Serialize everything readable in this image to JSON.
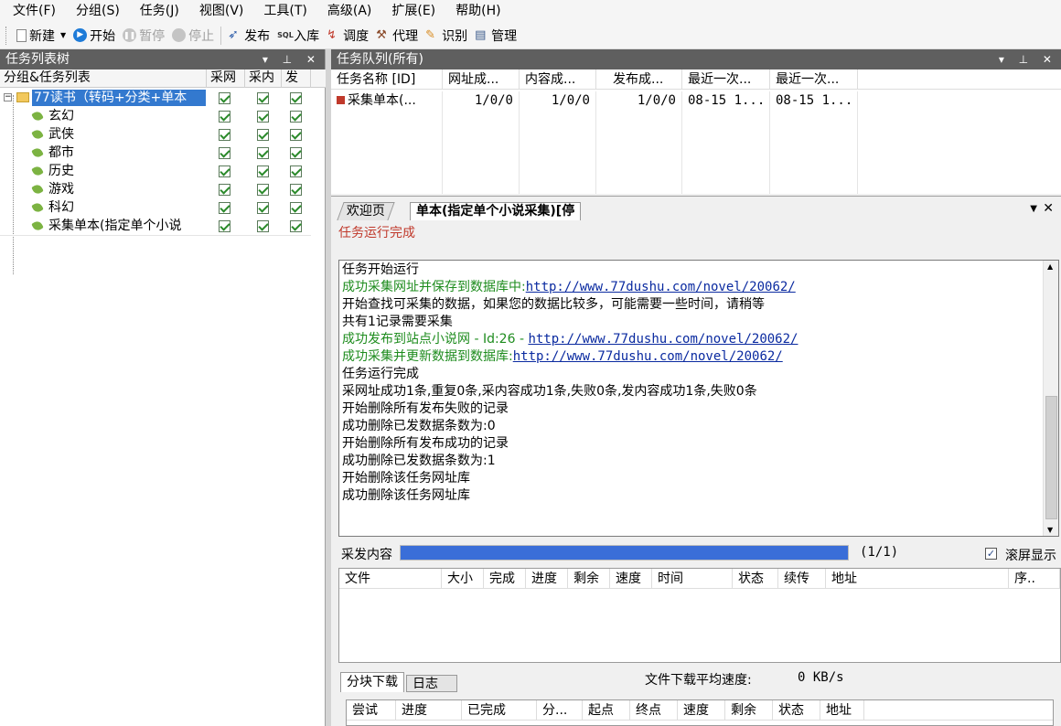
{
  "menu": [
    "文件(F)",
    "分组(S)",
    "任务(J)",
    "视图(V)",
    "工具(T)",
    "高级(A)",
    "扩展(E)",
    "帮助(H)"
  ],
  "toolbar": {
    "new": "新建",
    "start": "开始",
    "pause": "暂停",
    "stop": "停止",
    "publish": "发布",
    "import": "入库",
    "debug": "调度",
    "proxy": "代理",
    "recognize": "识别",
    "manage": "管理"
  },
  "left_panel": {
    "title": "任务列表树",
    "columns": [
      "分组&任务列表",
      "采网",
      "采内",
      "发"
    ],
    "group": "77读书（转码+分类+单本",
    "items": [
      "玄幻",
      "武侠",
      "都市",
      "历史",
      "游戏",
      "科幻",
      "采集单本(指定单个小说"
    ]
  },
  "queue_panel": {
    "title": "任务队列(所有)",
    "columns": [
      "任务名称 [ID]",
      "网址成...",
      "内容成...",
      "发布成...",
      "最近一次...",
      "最近一次..."
    ],
    "rows": [
      [
        "采集单本(...",
        "1/0/0",
        "1/0/0",
        "1/0/0",
        "08-15 1...",
        "08-15 1..."
      ]
    ]
  },
  "tabs": {
    "welcome": "欢迎页",
    "active": "单本(指定单个小说采集)[停"
  },
  "status_text": "任务运行完成",
  "log": [
    {
      "text": "任务开始运行",
      "color": "black",
      "link": ""
    },
    {
      "text": "成功采集网址并保存到数据库中:",
      "color": "green",
      "link": "http://www.77dushu.com/novel/20062/"
    },
    {
      "text": "开始查找可采集的数据，如果您的数据比较多，可能需要一些时间，请稍等",
      "color": "black",
      "link": ""
    },
    {
      "text": "共有1记录需要采集",
      "color": "black",
      "link": ""
    },
    {
      "text": "成功发布到站点小说网 - Id:26 - ",
      "color": "green",
      "link": "http://www.77dushu.com/novel/20062/"
    },
    {
      "text": "成功采集并更新数据到数据库:",
      "color": "green",
      "link": "http://www.77dushu.com/novel/20062/"
    },
    {
      "text": "任务运行完成",
      "color": "black",
      "link": ""
    },
    {
      "text": "采网址成功1条,重复0条,采内容成功1条,失败0条,发内容成功1条,失败0条",
      "color": "black",
      "link": ""
    },
    {
      "text": "开始删除所有发布失败的记录",
      "color": "black",
      "link": ""
    },
    {
      "text": "成功删除已发数据条数为:0",
      "color": "black",
      "link": ""
    },
    {
      "text": "开始删除所有发布成功的记录",
      "color": "black",
      "link": ""
    },
    {
      "text": "成功删除已发数据条数为:1",
      "color": "black",
      "link": ""
    },
    {
      "text": "开始删除该任务网址库",
      "color": "black",
      "link": ""
    },
    {
      "text": "成功删除该任务网址库",
      "color": "black",
      "link": ""
    }
  ],
  "progress": {
    "label": "采发内容",
    "fraction": 1.0,
    "count_text": "(1/1)",
    "scroll_label": "滚屏显示"
  },
  "file_grid": {
    "columns": [
      "文件",
      "大小",
      "完成",
      "进度",
      "剩余",
      "速度",
      "时间",
      "状态",
      "续传",
      "地址",
      "序.."
    ]
  },
  "bottom": {
    "tabs": [
      "分块下载",
      "日志"
    ],
    "avg_speed_label": "文件下载平均速度:",
    "avg_speed_value": "0 KB/s",
    "columns": [
      "尝试",
      "进度",
      "已完成",
      "分...",
      "起点",
      "终点",
      "速度",
      "剩余",
      "状态",
      "地址"
    ]
  },
  "colors": {
    "selection": "#3379cf",
    "progress": "#3a6ed8",
    "status": "#c0392b",
    "log_green": "#1e8c1e",
    "panel_title": "#5f5f5f"
  }
}
